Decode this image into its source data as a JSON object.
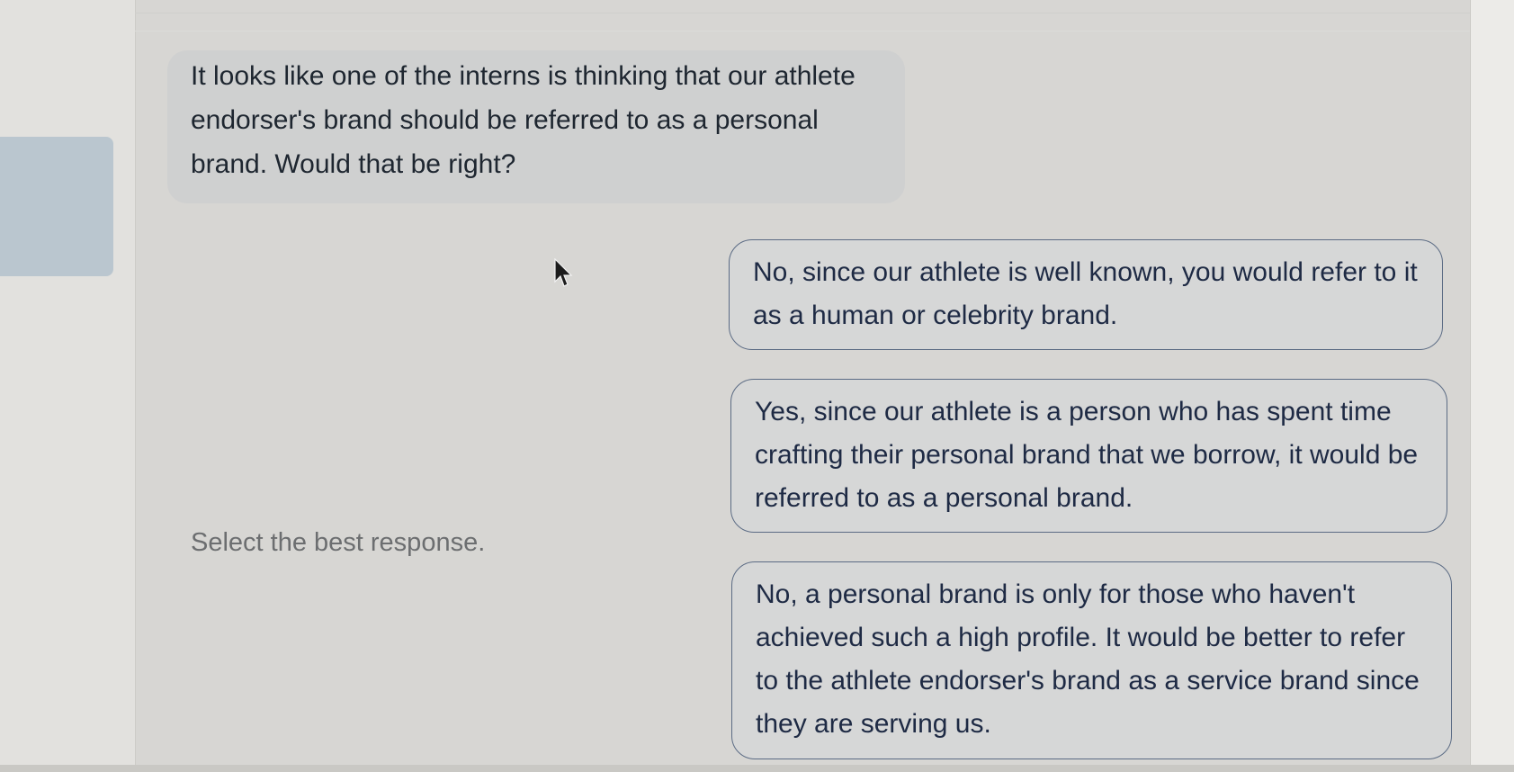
{
  "question": {
    "text": "It looks like one of the interns is thinking that our athlete endorser's brand should be referred to as a personal brand. Would that be right?"
  },
  "prompt": {
    "text": "Select the best response."
  },
  "options": [
    {
      "text": "No, since our athlete is well known, you would refer to it as a human or celebrity brand."
    },
    {
      "text": "Yes, since our athlete is a person who has spent time crafting their personal brand that we borrow, it would be referred to as a personal brand."
    },
    {
      "text": "No, a personal brand is only for those who haven't achieved such a high profile. It would be better to refer to the athlete endorser's brand as a service brand since they are serving us."
    }
  ]
}
